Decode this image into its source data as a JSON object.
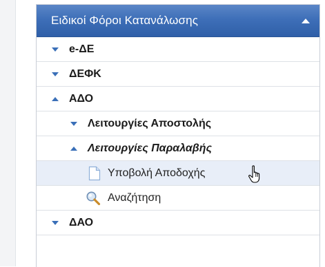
{
  "menu": {
    "title": "Ειδικοί Φόροι Κατανάλωσης",
    "items": [
      {
        "label": "e-ΔΕ"
      },
      {
        "label": "ΔΕΦΚ"
      },
      {
        "label": "ΑΔΟ"
      },
      {
        "label": "Λειτουργίες Αποστολής"
      },
      {
        "label": "Λειτουργίες Παραλαβής"
      },
      {
        "label": "Υποβολή Αποδοχής"
      },
      {
        "label": "Αναζήτηση"
      },
      {
        "label": "ΔΑΟ"
      }
    ]
  },
  "colors": {
    "header": "#3e6fb8",
    "accent": "#3a6fb8",
    "selected_row": "#e8eef8"
  }
}
